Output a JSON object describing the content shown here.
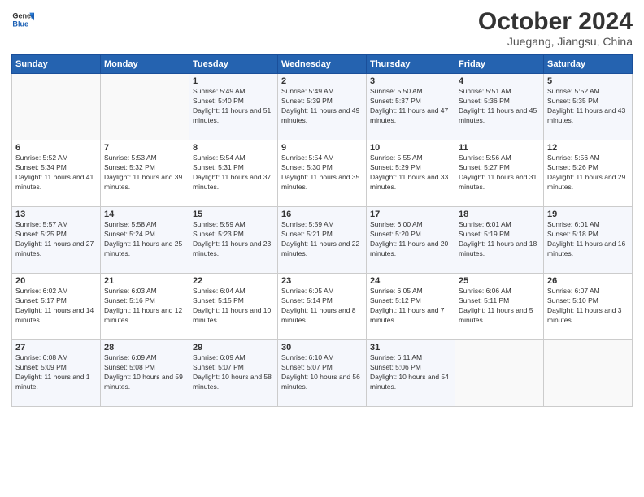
{
  "header": {
    "logo_line1": "General",
    "logo_line2": "Blue",
    "month": "October 2024",
    "location": "Juegang, Jiangsu, China"
  },
  "weekdays": [
    "Sunday",
    "Monday",
    "Tuesday",
    "Wednesday",
    "Thursday",
    "Friday",
    "Saturday"
  ],
  "weeks": [
    [
      {
        "day": "",
        "info": ""
      },
      {
        "day": "",
        "info": ""
      },
      {
        "day": "1",
        "info": "Sunrise: 5:49 AM\nSunset: 5:40 PM\nDaylight: 11 hours and 51 minutes."
      },
      {
        "day": "2",
        "info": "Sunrise: 5:49 AM\nSunset: 5:39 PM\nDaylight: 11 hours and 49 minutes."
      },
      {
        "day": "3",
        "info": "Sunrise: 5:50 AM\nSunset: 5:37 PM\nDaylight: 11 hours and 47 minutes."
      },
      {
        "day": "4",
        "info": "Sunrise: 5:51 AM\nSunset: 5:36 PM\nDaylight: 11 hours and 45 minutes."
      },
      {
        "day": "5",
        "info": "Sunrise: 5:52 AM\nSunset: 5:35 PM\nDaylight: 11 hours and 43 minutes."
      }
    ],
    [
      {
        "day": "6",
        "info": "Sunrise: 5:52 AM\nSunset: 5:34 PM\nDaylight: 11 hours and 41 minutes."
      },
      {
        "day": "7",
        "info": "Sunrise: 5:53 AM\nSunset: 5:32 PM\nDaylight: 11 hours and 39 minutes."
      },
      {
        "day": "8",
        "info": "Sunrise: 5:54 AM\nSunset: 5:31 PM\nDaylight: 11 hours and 37 minutes."
      },
      {
        "day": "9",
        "info": "Sunrise: 5:54 AM\nSunset: 5:30 PM\nDaylight: 11 hours and 35 minutes."
      },
      {
        "day": "10",
        "info": "Sunrise: 5:55 AM\nSunset: 5:29 PM\nDaylight: 11 hours and 33 minutes."
      },
      {
        "day": "11",
        "info": "Sunrise: 5:56 AM\nSunset: 5:27 PM\nDaylight: 11 hours and 31 minutes."
      },
      {
        "day": "12",
        "info": "Sunrise: 5:56 AM\nSunset: 5:26 PM\nDaylight: 11 hours and 29 minutes."
      }
    ],
    [
      {
        "day": "13",
        "info": "Sunrise: 5:57 AM\nSunset: 5:25 PM\nDaylight: 11 hours and 27 minutes."
      },
      {
        "day": "14",
        "info": "Sunrise: 5:58 AM\nSunset: 5:24 PM\nDaylight: 11 hours and 25 minutes."
      },
      {
        "day": "15",
        "info": "Sunrise: 5:59 AM\nSunset: 5:23 PM\nDaylight: 11 hours and 23 minutes."
      },
      {
        "day": "16",
        "info": "Sunrise: 5:59 AM\nSunset: 5:21 PM\nDaylight: 11 hours and 22 minutes."
      },
      {
        "day": "17",
        "info": "Sunrise: 6:00 AM\nSunset: 5:20 PM\nDaylight: 11 hours and 20 minutes."
      },
      {
        "day": "18",
        "info": "Sunrise: 6:01 AM\nSunset: 5:19 PM\nDaylight: 11 hours and 18 minutes."
      },
      {
        "day": "19",
        "info": "Sunrise: 6:01 AM\nSunset: 5:18 PM\nDaylight: 11 hours and 16 minutes."
      }
    ],
    [
      {
        "day": "20",
        "info": "Sunrise: 6:02 AM\nSunset: 5:17 PM\nDaylight: 11 hours and 14 minutes."
      },
      {
        "day": "21",
        "info": "Sunrise: 6:03 AM\nSunset: 5:16 PM\nDaylight: 11 hours and 12 minutes."
      },
      {
        "day": "22",
        "info": "Sunrise: 6:04 AM\nSunset: 5:15 PM\nDaylight: 11 hours and 10 minutes."
      },
      {
        "day": "23",
        "info": "Sunrise: 6:05 AM\nSunset: 5:14 PM\nDaylight: 11 hours and 8 minutes."
      },
      {
        "day": "24",
        "info": "Sunrise: 6:05 AM\nSunset: 5:12 PM\nDaylight: 11 hours and 7 minutes."
      },
      {
        "day": "25",
        "info": "Sunrise: 6:06 AM\nSunset: 5:11 PM\nDaylight: 11 hours and 5 minutes."
      },
      {
        "day": "26",
        "info": "Sunrise: 6:07 AM\nSunset: 5:10 PM\nDaylight: 11 hours and 3 minutes."
      }
    ],
    [
      {
        "day": "27",
        "info": "Sunrise: 6:08 AM\nSunset: 5:09 PM\nDaylight: 11 hours and 1 minute."
      },
      {
        "day": "28",
        "info": "Sunrise: 6:09 AM\nSunset: 5:08 PM\nDaylight: 10 hours and 59 minutes."
      },
      {
        "day": "29",
        "info": "Sunrise: 6:09 AM\nSunset: 5:07 PM\nDaylight: 10 hours and 58 minutes."
      },
      {
        "day": "30",
        "info": "Sunrise: 6:10 AM\nSunset: 5:07 PM\nDaylight: 10 hours and 56 minutes."
      },
      {
        "day": "31",
        "info": "Sunrise: 6:11 AM\nSunset: 5:06 PM\nDaylight: 10 hours and 54 minutes."
      },
      {
        "day": "",
        "info": ""
      },
      {
        "day": "",
        "info": ""
      }
    ]
  ]
}
